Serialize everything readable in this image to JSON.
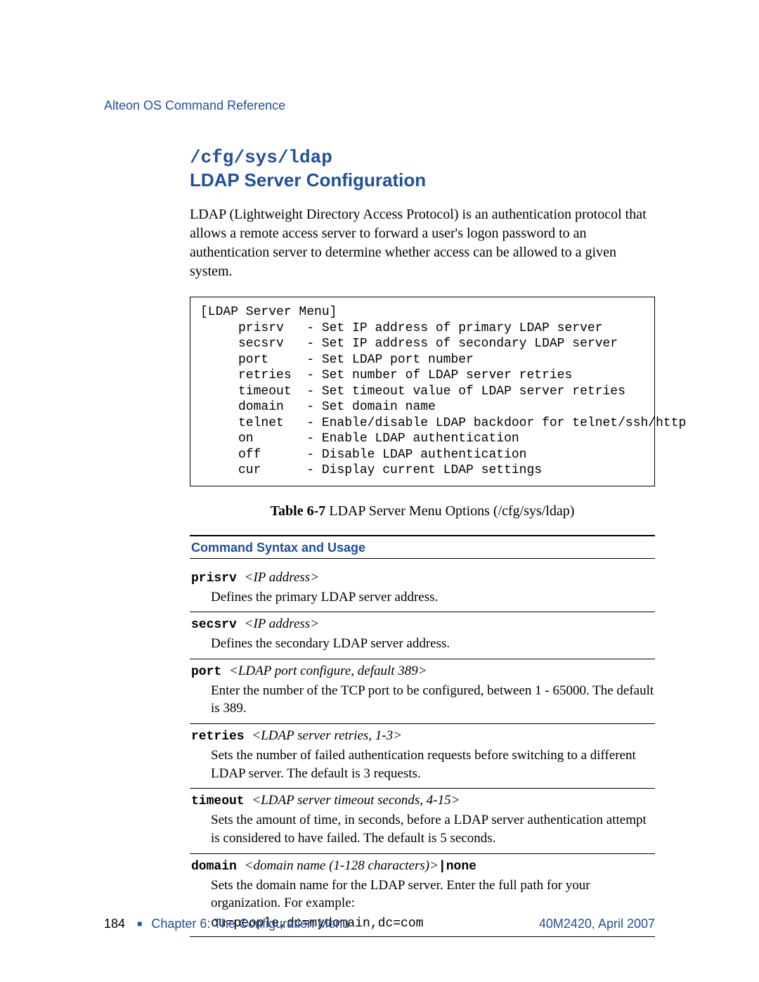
{
  "header": {
    "running_head": "Alteon OS Command Reference"
  },
  "title": {
    "path": "/cfg/sys/ldap",
    "name": "LDAP Server Configuration"
  },
  "intro": "LDAP (Lightweight Directory Access Protocol) is an authentication protocol that allows a remote access server to forward a user's logon password to an authentication server to determine whether access can be allowed to a given system.",
  "menu_block": "[LDAP Server Menu]\n     prisrv   - Set IP address of primary LDAP server\n     secsrv   - Set IP address of secondary LDAP server\n     port     - Set LDAP port number\n     retries  - Set number of LDAP server retries\n     timeout  - Set timeout value of LDAP server retries\n     domain   - Set domain name\n     telnet   - Enable/disable LDAP backdoor for telnet/ssh/http\n     on       - Enable LDAP authentication\n     off      - Disable LDAP authentication\n     cur      - Display current LDAP settings",
  "table_caption": {
    "label": "Table 6-7",
    "text": "  LDAP Server Menu Options (/cfg/sys/ldap)"
  },
  "syntax_header": "Command Syntax and Usage",
  "entries": [
    {
      "cmd": "prisrv ",
      "arg": "<IP address>",
      "desc": "Defines the primary LDAP server address."
    },
    {
      "cmd": "secsrv ",
      "arg": "<IP address>",
      "desc": "Defines the secondary LDAP server address."
    },
    {
      "cmd": "port ",
      "arg": "<LDAP port configure, default 389>",
      "desc": "Enter the number of the TCP port to be configured, between 1 - 65000. The default is 389."
    },
    {
      "cmd": "retries ",
      "arg": "<LDAP server retries, 1-3>",
      "desc": "Sets the number of failed authentication requests before switching to a different LDAP server. The default is 3 requests."
    },
    {
      "cmd": "timeout ",
      "arg": "<LDAP server timeout seconds, 4-15>",
      "desc": "Sets the amount of time, in seconds, before a LDAP server authentication attempt is considered to have failed. The default is 5 seconds."
    },
    {
      "cmd": "domain ",
      "arg": "<domain name (1-128 characters)>",
      "pipe": "|",
      "opt": "none",
      "desc": "Sets the domain name for the LDAP server. Enter the full path for your organization. For example:",
      "mono": "ou=people,dc=mydomain,dc=com"
    }
  ],
  "footer": {
    "page_num": "184",
    "marker": "■",
    "chapter": "Chapter 6:  The Configuration Menu",
    "doc_id": "40M2420, April 2007"
  }
}
